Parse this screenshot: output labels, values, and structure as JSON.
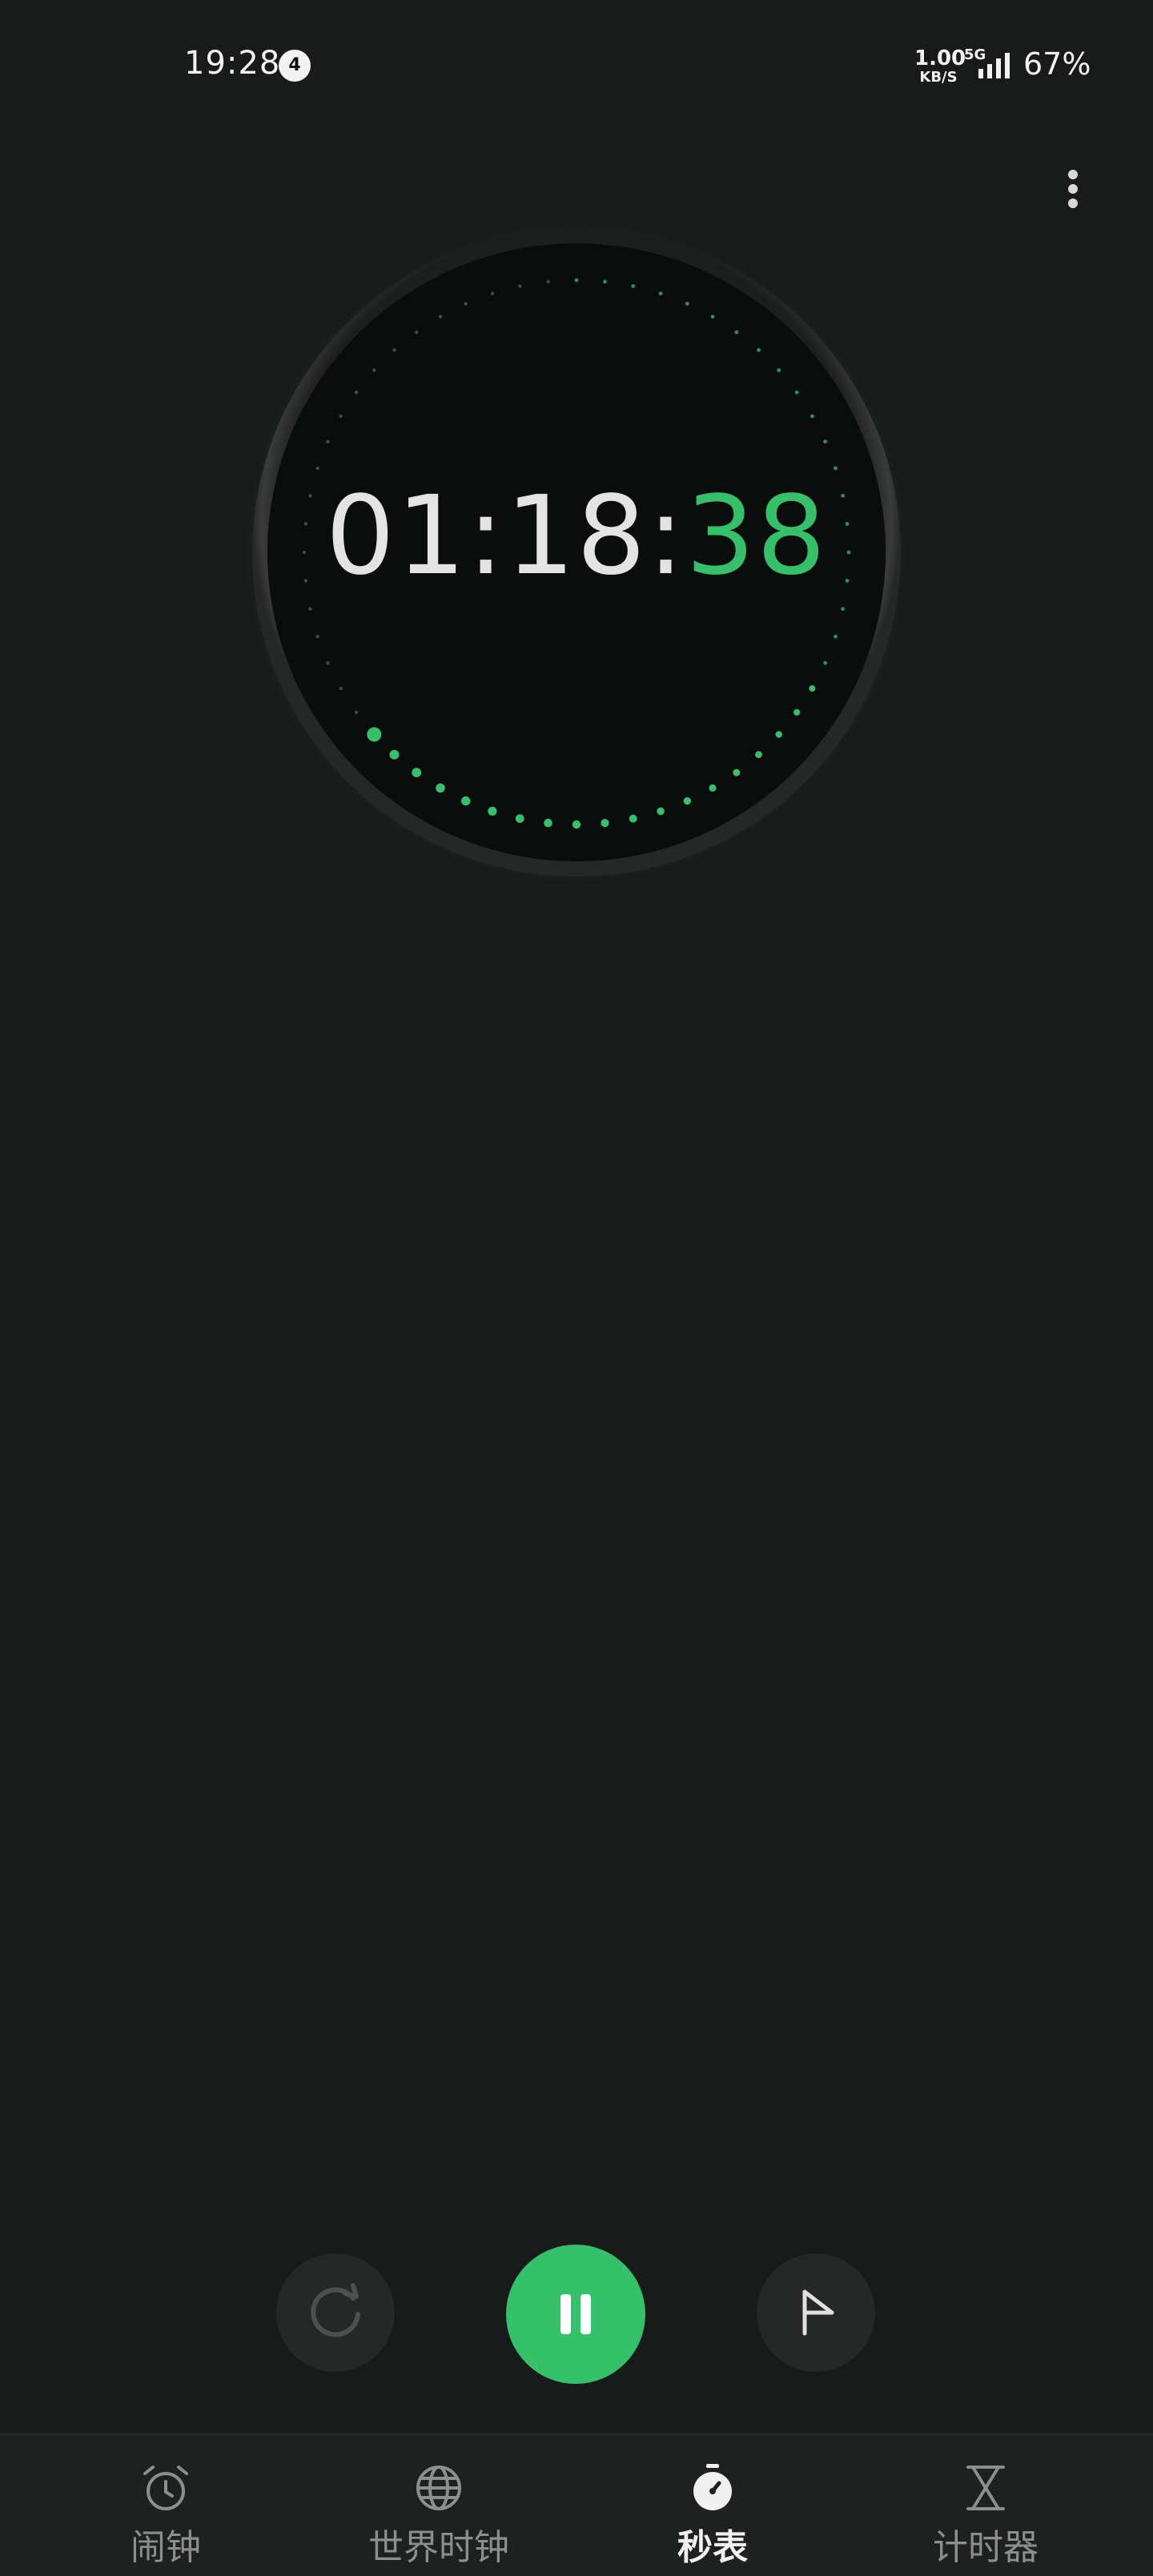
{
  "status_bar": {
    "time": "19:28",
    "notification_count": "4",
    "net_speed_value": "1.00",
    "net_speed_unit": "KB/S",
    "network_type": "5G",
    "battery": "67%"
  },
  "stopwatch": {
    "time_main": "01:18:",
    "time_seconds": "38",
    "progress_fraction": 0.633
  },
  "controls": {
    "reset_icon": "reset-icon",
    "pause_icon": "pause-icon",
    "lap_icon": "flag-icon"
  },
  "nav": {
    "items": [
      {
        "label": "闹钟",
        "icon": "alarm-clock-icon"
      },
      {
        "label": "世界时钟",
        "icon": "globe-icon"
      },
      {
        "label": "秒表",
        "icon": "stopwatch-icon"
      },
      {
        "label": "计时器",
        "icon": "hourglass-icon"
      }
    ],
    "active_index": 2
  },
  "colors": {
    "background": "#191a1a",
    "accent": "#35c06a"
  }
}
